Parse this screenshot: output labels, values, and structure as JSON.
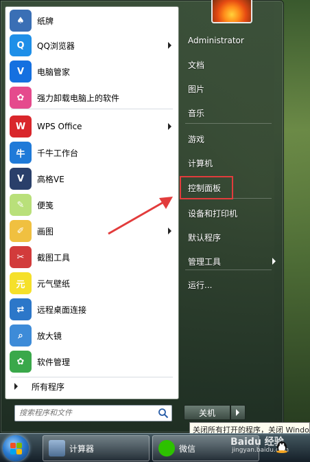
{
  "start_menu": {
    "programs": [
      {
        "label": "纸牌",
        "icon": "solitaire-icon",
        "color": "#3a6fb5",
        "has_submenu": false
      },
      {
        "label": "QQ浏览器",
        "icon": "qq-browser-icon",
        "color": "#1e8fe8",
        "has_submenu": true
      },
      {
        "label": "电脑管家",
        "icon": "pc-manager-icon",
        "color": "#1570e0",
        "has_submenu": false
      },
      {
        "label": "强力卸载电脑上的软件",
        "icon": "uninstaller-icon",
        "color": "#e54a8d",
        "has_submenu": false
      },
      {
        "label": "WPS Office",
        "icon": "wps-icon",
        "color": "#d9262b",
        "has_submenu": true
      },
      {
        "label": "千牛工作台",
        "icon": "qianniu-icon",
        "color": "#1f7ad8",
        "has_submenu": false
      },
      {
        "label": "高格VE",
        "icon": "gaoge-ve-icon",
        "color": "#2a3f6a",
        "has_submenu": false
      },
      {
        "label": "便笺",
        "icon": "sticky-notes-icon",
        "color": "#b9e07a",
        "has_submenu": false
      },
      {
        "label": "画图",
        "icon": "paint-icon",
        "color": "#f0c040",
        "has_submenu": true
      },
      {
        "label": "截图工具",
        "icon": "snipping-tool-icon",
        "color": "#d23b3b",
        "has_submenu": false
      },
      {
        "label": "元气壁纸",
        "icon": "yuanqi-wallpaper-icon",
        "color": "#f5e02a",
        "has_submenu": false
      },
      {
        "label": "远程桌面连接",
        "icon": "remote-desktop-icon",
        "color": "#2c77c9",
        "has_submenu": false
      },
      {
        "label": "放大镜",
        "icon": "magnifier-icon",
        "color": "#3d8bd8",
        "has_submenu": false
      },
      {
        "label": "软件管理",
        "icon": "software-manager-icon",
        "color": "#3aa84a",
        "has_submenu": false
      }
    ],
    "all_programs_label": "所有程序",
    "search_placeholder": "搜索程序和文件"
  },
  "right_pane": {
    "items": [
      {
        "label": "Administrator",
        "has_submenu": false
      },
      {
        "label": "文档",
        "has_submenu": false
      },
      {
        "label": "图片",
        "has_submenu": false
      },
      {
        "label": "音乐",
        "has_submenu": false
      },
      {
        "label": "游戏",
        "has_submenu": false
      },
      {
        "label": "计算机",
        "has_submenu": false
      },
      {
        "label": "控制面板",
        "has_submenu": false
      },
      {
        "label": "设备和打印机",
        "has_submenu": false
      },
      {
        "label": "默认程序",
        "has_submenu": false
      },
      {
        "label": "管理工具",
        "has_submenu": true
      },
      {
        "label": "运行...",
        "has_submenu": false
      }
    ],
    "highlighted": "控制面板",
    "highlight_color": "#e23c3c",
    "shutdown_label": "关机",
    "tooltip": "关闭所有打开的程序，关闭 Windows"
  },
  "taskbar": {
    "buttons": [
      {
        "label": "计算器",
        "icon": "calculator-icon"
      },
      {
        "label": "微信",
        "icon": "wechat-icon"
      }
    ],
    "watermark": "Baidu 经验",
    "watermark_url": "jingyan.baidu.com"
  }
}
